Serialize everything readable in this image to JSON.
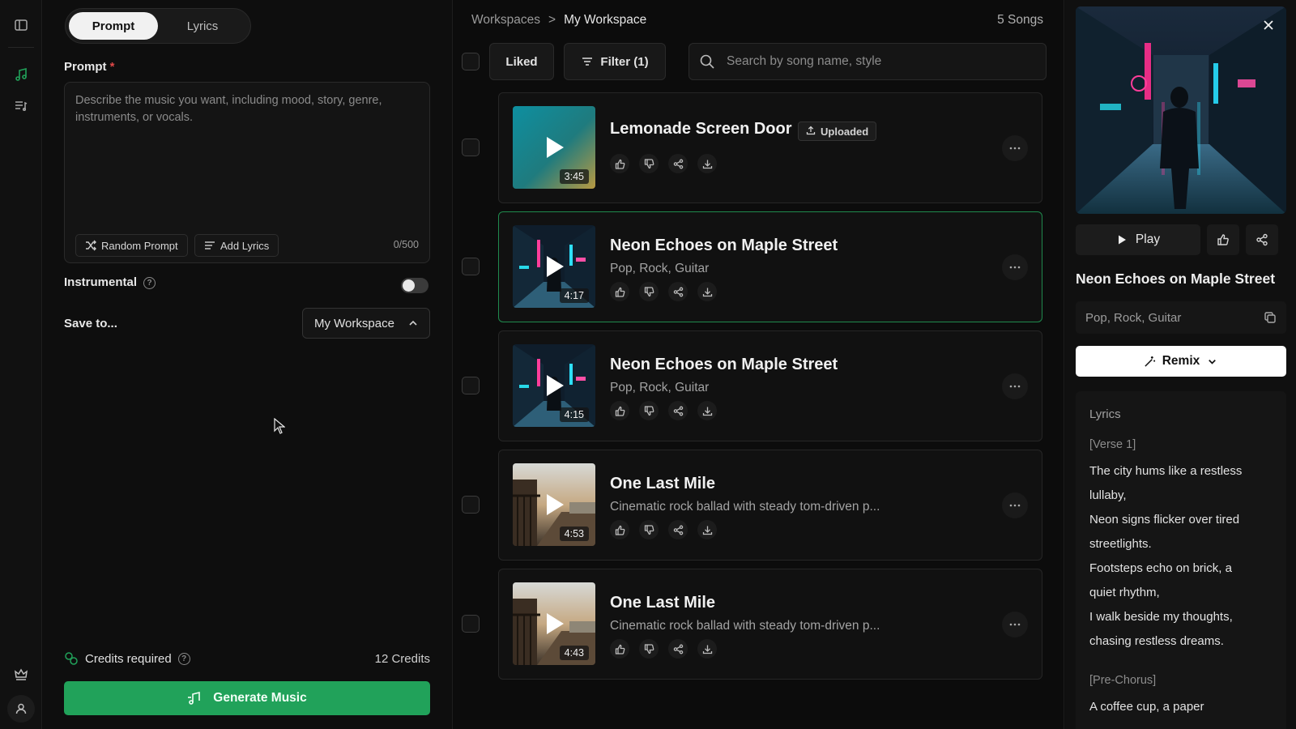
{
  "prompt_panel": {
    "tabs": [
      {
        "label": "Prompt",
        "active": true
      },
      {
        "label": "Lyrics",
        "active": false
      }
    ],
    "prompt_label": "Prompt",
    "required_mark": "*",
    "prompt_placeholder": "Describe the music you want, including mood, story, genre, instruments, or vocals.",
    "prompt_value": "",
    "random_prompt_label": "Random Prompt",
    "add_lyrics_label": "Add Lyrics",
    "char_counter": "0/500",
    "instrumental_label": "Instrumental",
    "instrumental_on": false,
    "save_to_label": "Save to...",
    "save_to_value": "My Workspace",
    "credits_label": "Credits required",
    "credits_value": "12 Credits",
    "generate_label": "Generate Music"
  },
  "list_panel": {
    "breadcrumb": {
      "root": "Workspaces",
      "separator": ">",
      "current": "My Workspace"
    },
    "song_count": "5 Songs",
    "liked_label": "Liked",
    "filter_label": "Filter (1)",
    "search_placeholder": "Search by song name, style",
    "songs": [
      {
        "title": "Lemonade Screen Door",
        "subtitle": "",
        "badge": "Uploaded",
        "duration": "3:45",
        "art": "teal-gold",
        "selected": false
      },
      {
        "title": "Neon Echoes on Maple Street",
        "subtitle": "Pop, Rock, Guitar",
        "badge": "",
        "duration": "4:17",
        "art": "neon-city",
        "selected": true
      },
      {
        "title": "Neon Echoes on Maple Street",
        "subtitle": "Pop, Rock, Guitar",
        "badge": "",
        "duration": "4:15",
        "art": "neon-city",
        "selected": false
      },
      {
        "title": "One Last Mile",
        "subtitle": "Cinematic rock ballad with steady tom-driven p...",
        "badge": "",
        "duration": "4:53",
        "art": "sunset-porch",
        "selected": false
      },
      {
        "title": "One Last Mile",
        "subtitle": "Cinematic rock ballad with steady tom-driven p...",
        "badge": "",
        "duration": "4:43",
        "art": "sunset-porch",
        "selected": false
      }
    ]
  },
  "detail": {
    "play_label": "Play",
    "title": "Neon Echoes on Maple Street",
    "style": "Pop, Rock, Guitar",
    "remix_label": "Remix",
    "lyrics_heading": "Lyrics",
    "lyrics": [
      {
        "type": "section",
        "text": "[Verse 1]"
      },
      {
        "type": "line",
        "text": "The city hums like a restless"
      },
      {
        "type": "line",
        "text": "lullaby,"
      },
      {
        "type": "line",
        "text": "Neon signs flicker over tired"
      },
      {
        "type": "line",
        "text": "streetlights."
      },
      {
        "type": "line",
        "text": "Footsteps echo on brick, a"
      },
      {
        "type": "line",
        "text": "quiet rhythm,"
      },
      {
        "type": "line",
        "text": "I walk beside my thoughts,"
      },
      {
        "type": "line",
        "text": "chasing restless dreams."
      },
      {
        "type": "gap",
        "text": ""
      },
      {
        "type": "section",
        "text": "[Pre-Chorus]"
      },
      {
        "type": "line",
        "text": "A coffee cup, a paper"
      }
    ]
  },
  "colors": {
    "accent": "#21a25a",
    "selected_border": "#1f8a4d",
    "background": "#0c0c0c"
  },
  "icons": [
    "sidebar-toggle-icon",
    "music-note-icon",
    "playlist-icon",
    "crown-icon",
    "user-icon",
    "shuffle-icon",
    "lyrics-icon",
    "help-icon",
    "chevron-up-icon",
    "credits-icon",
    "filter-icon",
    "search-icon",
    "play-icon",
    "upload-icon",
    "thumbs-up-icon",
    "thumbs-down-icon",
    "share-icon",
    "download-icon",
    "more-icon",
    "close-icon",
    "copy-icon",
    "wand-icon",
    "chevron-down-icon"
  ]
}
